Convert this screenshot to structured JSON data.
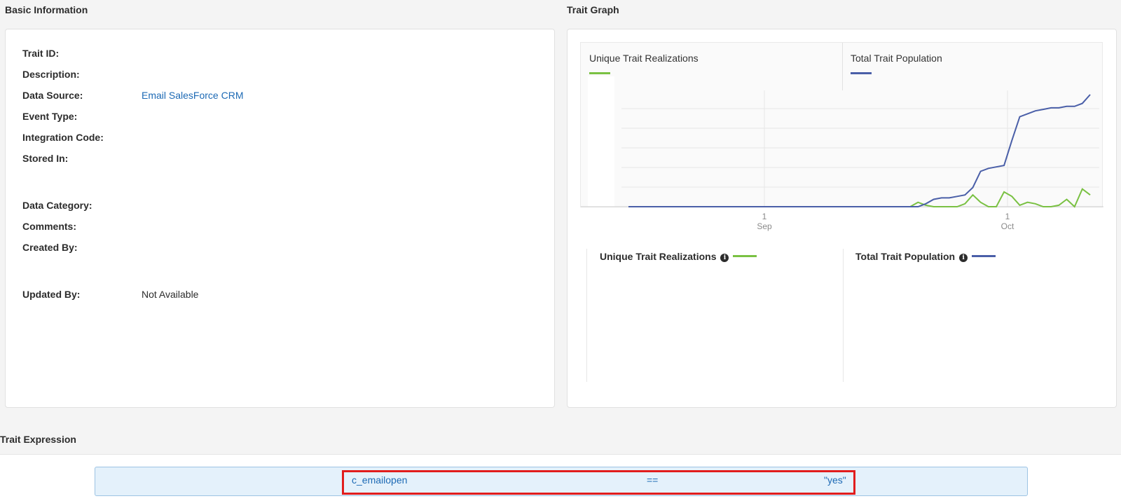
{
  "basic_info": {
    "title": "Basic Information",
    "fields": [
      {
        "label": "Trait ID:",
        "value": ""
      },
      {
        "label": "Description:",
        "value": ""
      },
      {
        "label": "Data Source:",
        "value": "Email SalesForce CRM"
      },
      {
        "label": "Event Type:",
        "value": ""
      },
      {
        "label": "Integration Code:",
        "value": ""
      },
      {
        "label": "Stored In:",
        "value": ""
      },
      {
        "label": "Data Category:",
        "value": ""
      },
      {
        "label": "Comments:",
        "value": ""
      },
      {
        "label": "Created By:",
        "value": ""
      },
      {
        "label": "Updated By:",
        "value": "Not Available"
      }
    ]
  },
  "trait_graph": {
    "title": "Trait Graph",
    "tabs": [
      {
        "label": "Unique Trait Realizations",
        "color": "#7ac143"
      },
      {
        "label": "Total Trait Population",
        "color": "#4a5fa8"
      }
    ],
    "legend": [
      {
        "label": "Unique Trait Realizations",
        "color": "#7ac143"
      },
      {
        "label": "Total Trait Population",
        "color": "#4a5fa8"
      }
    ]
  },
  "chart_data": {
    "type": "line",
    "x_ticks": [
      {
        "day": "1",
        "month": "Sep"
      },
      {
        "day": "1",
        "month": "Oct"
      }
    ],
    "grid": true,
    "series": [
      {
        "name": "Unique Trait Realizations",
        "color": "#7ac143",
        "values": [
          0,
          0,
          0,
          0,
          0,
          0,
          0,
          0,
          0,
          0,
          0,
          0,
          0,
          0,
          0,
          0,
          0,
          0,
          0,
          0,
          0,
          0,
          0,
          0,
          0,
          0,
          0,
          0,
          0,
          0,
          0,
          0,
          0,
          0,
          0,
          0,
          0,
          3,
          1,
          0,
          0,
          0,
          0,
          2,
          8,
          3,
          0,
          0,
          10,
          7,
          1,
          3,
          2,
          0,
          0,
          1,
          5,
          0,
          12,
          8
        ]
      },
      {
        "name": "Total Trait Population",
        "color": "#4a5fa8",
        "values": [
          0,
          0,
          0,
          0,
          0,
          0,
          0,
          0,
          0,
          0,
          0,
          0,
          0,
          0,
          0,
          0,
          0,
          0,
          0,
          0,
          0,
          0,
          0,
          0,
          0,
          0,
          0,
          0,
          0,
          0,
          0,
          0,
          0,
          0,
          0,
          0,
          0,
          0,
          2,
          5,
          6,
          6,
          7,
          8,
          13,
          24,
          26,
          27,
          28,
          45,
          61,
          63,
          65,
          66,
          67,
          67,
          68,
          68,
          70,
          76
        ]
      }
    ]
  },
  "trait_expression": {
    "title": "Trait Expression",
    "key": "c_emailopen",
    "operator": "==",
    "value": "\"yes\""
  }
}
